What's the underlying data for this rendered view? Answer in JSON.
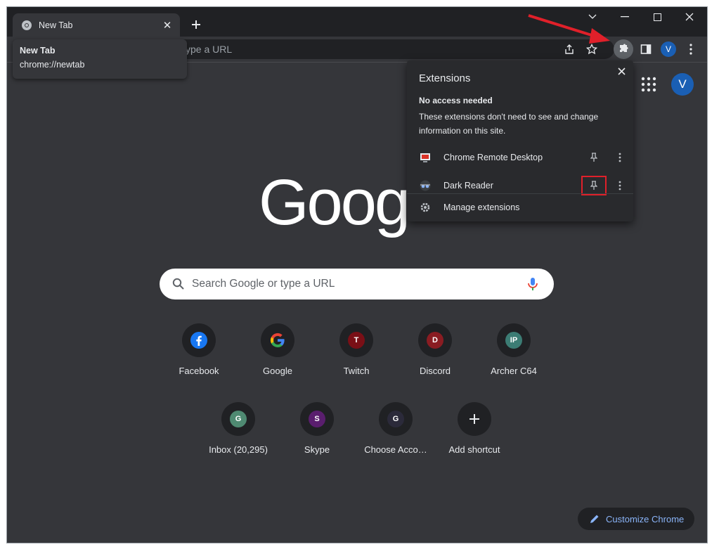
{
  "tab": {
    "title": "New Tab",
    "close": "✕"
  },
  "hovercard": {
    "title": "New Tab",
    "url": "chrome://newtab"
  },
  "omnibox": {
    "placeholder": "ype a URL"
  },
  "toolbar": {
    "avatar": "V"
  },
  "extensions_popup": {
    "title": "Extensions",
    "section": "No access needed",
    "description": "These extensions don't need to see and change information on this site.",
    "items": [
      {
        "name": "Chrome Remote Desktop",
        "icon": "remote-desktop-icon"
      },
      {
        "name": "Dark Reader",
        "icon": "dark-reader-icon"
      }
    ],
    "manage": "Manage extensions"
  },
  "ntp": {
    "avatar": "V",
    "logo": "Goog",
    "search_placeholder": "Search Google or type a URL",
    "shortcuts_row1": [
      {
        "label": "Facebook",
        "letter": "f",
        "color": "#1877f2"
      },
      {
        "label": "Google",
        "letter": "G",
        "color": "#ffffff"
      },
      {
        "label": "Twitch",
        "letter": "T",
        "color": "#7a0f16"
      },
      {
        "label": "Discord",
        "letter": "D",
        "color": "#8a1c22"
      },
      {
        "label": "Archer C64",
        "letter": "IP",
        "color": "#3c7c74"
      }
    ],
    "shortcuts_row2": [
      {
        "label": "Inbox (20,295)",
        "letter": "G",
        "color": "#4f8a72"
      },
      {
        "label": "Skype",
        "letter": "S",
        "color": "#5a1e6e"
      },
      {
        "label": "Choose Acco…",
        "letter": "G",
        "color": "#2b2a3a"
      },
      {
        "label": "Add shortcut",
        "letter": "+",
        "color": "#202124"
      }
    ],
    "customize": "Customize Chrome"
  },
  "colors": {
    "annotation_red": "#e0202a",
    "link_blue": "#8ab4f8"
  }
}
